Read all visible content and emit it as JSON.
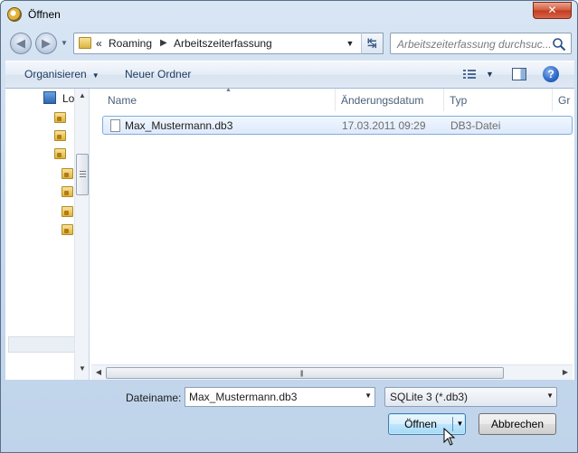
{
  "window": {
    "title": "Öffnen",
    "close_label": "✕"
  },
  "nav": {
    "back_glyph": "◀",
    "forward_glyph": "▶",
    "breadcrumb": {
      "overflow": "«",
      "items": [
        "Roaming",
        "Arbeitszeiterfassung"
      ],
      "separator": "▶"
    },
    "refresh_glyph": "↹",
    "search": {
      "placeholder": "Arbeitszeiterfassung durchsuc..."
    }
  },
  "toolbar": {
    "organize_label": "Organisieren",
    "new_folder_label": "Neuer Ordner",
    "help_label": "?"
  },
  "navpane": {
    "items": [
      {
        "label": "Lo",
        "icon": "computer-icon"
      }
    ]
  },
  "filelist": {
    "columns": [
      "Name",
      "Änderungsdatum",
      "Typ",
      "Gr"
    ],
    "rows": [
      {
        "name": "Max_Mustermann.db3",
        "date": "17.03.2011 09:29",
        "type": "DB3-Datei",
        "selected": true
      }
    ]
  },
  "footer": {
    "filename_label": "Dateiname:",
    "filename_value": "Max_Mustermann.db3",
    "filter_value": "SQLite 3 (*.db3)",
    "open_label": "Öffnen",
    "cancel_label": "Abbrechen"
  },
  "colors": {
    "selection": "#dceafc",
    "selection_border": "#84acdd",
    "chrome": "#c9dbef",
    "close": "#c23a1f"
  }
}
